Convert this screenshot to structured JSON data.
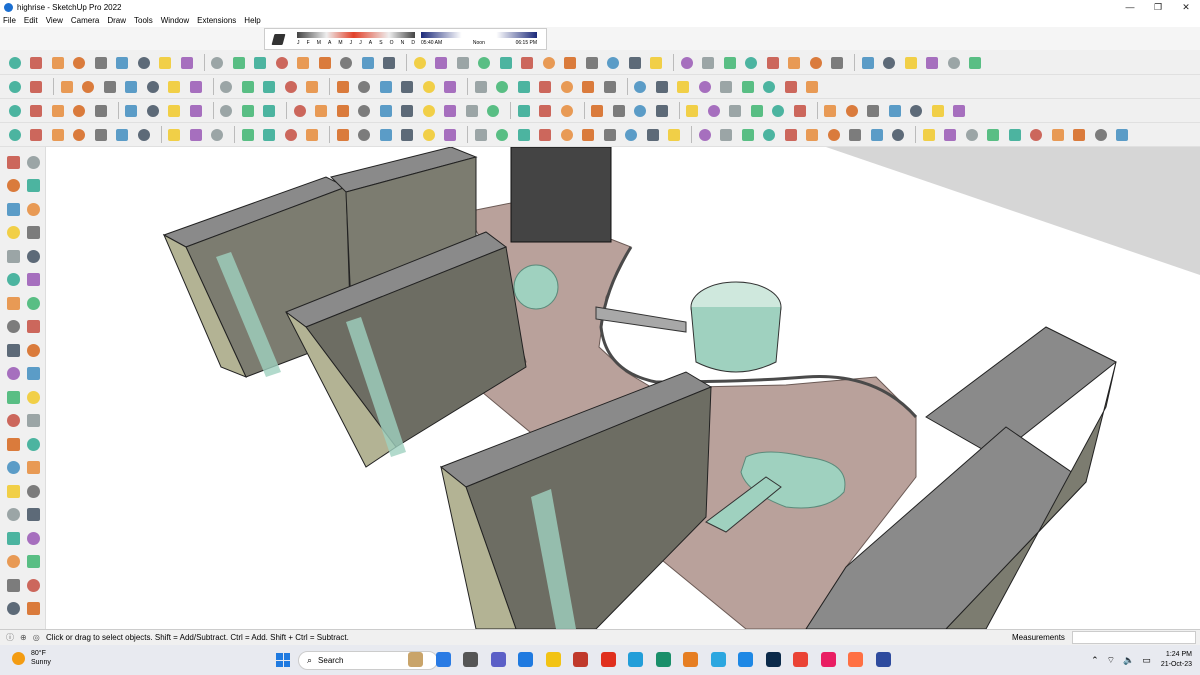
{
  "window": {
    "title": "highrise - SketchUp Pro 2022",
    "minimize": "—",
    "maximize": "❐",
    "close": "✕"
  },
  "menu": [
    "File",
    "Edit",
    "View",
    "Camera",
    "Draw",
    "Tools",
    "Window",
    "Extensions",
    "Help"
  ],
  "shadow_widget": {
    "months": [
      "J",
      "F",
      "M",
      "A",
      "M",
      "J",
      "J",
      "A",
      "S",
      "O",
      "N",
      "D"
    ],
    "time_start": "05:40 AM",
    "time_mid": "Noon",
    "time_end": "06:15 PM"
  },
  "status": {
    "hint": "Click or drag to select objects. Shift = Add/Subtract. Ctrl = Add. Shift + Ctrl = Subtract.",
    "measurements_label": "Measurements",
    "measurements_value": ""
  },
  "taskbar": {
    "weather_temp": "80°F",
    "weather_desc": "Sunny",
    "search_placeholder": "Search",
    "time": "1:24 PM",
    "date": "21-Oct-23"
  },
  "colors": {
    "accent": "#1f7ae0",
    "roof": "#8a8a8a",
    "plaza": "#b9a19b",
    "glass": "#9fd1bf",
    "facade": "#b3b394"
  }
}
